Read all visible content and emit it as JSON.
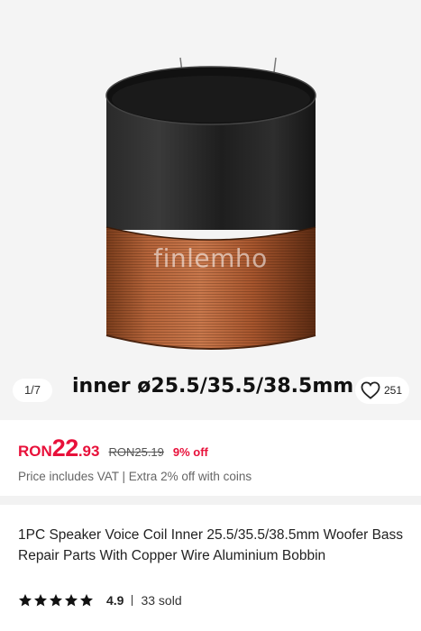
{
  "gallery": {
    "watermark": "finlemho",
    "counter": "1/7",
    "variant_caption": "inner ø25.5/35.5/38.5mm",
    "wishlist_count": "251"
  },
  "price": {
    "currency": "RON",
    "integer": "22",
    "decimal": ".93",
    "original": "RON25.19",
    "discount": "9% off",
    "note": "Price includes VAT | Extra 2% off with coins"
  },
  "product": {
    "title": "1PC Speaker Voice Coil Inner 25.5/35.5/38.5mm Woofer Bass Repair Parts With Copper Wire Aluminium Bobbin"
  },
  "rating": {
    "value": "4.9",
    "stars": 5,
    "sold": "33 sold"
  },
  "colors": {
    "accent": "#e8103a",
    "gallery_bg": "#f4f4f4"
  }
}
